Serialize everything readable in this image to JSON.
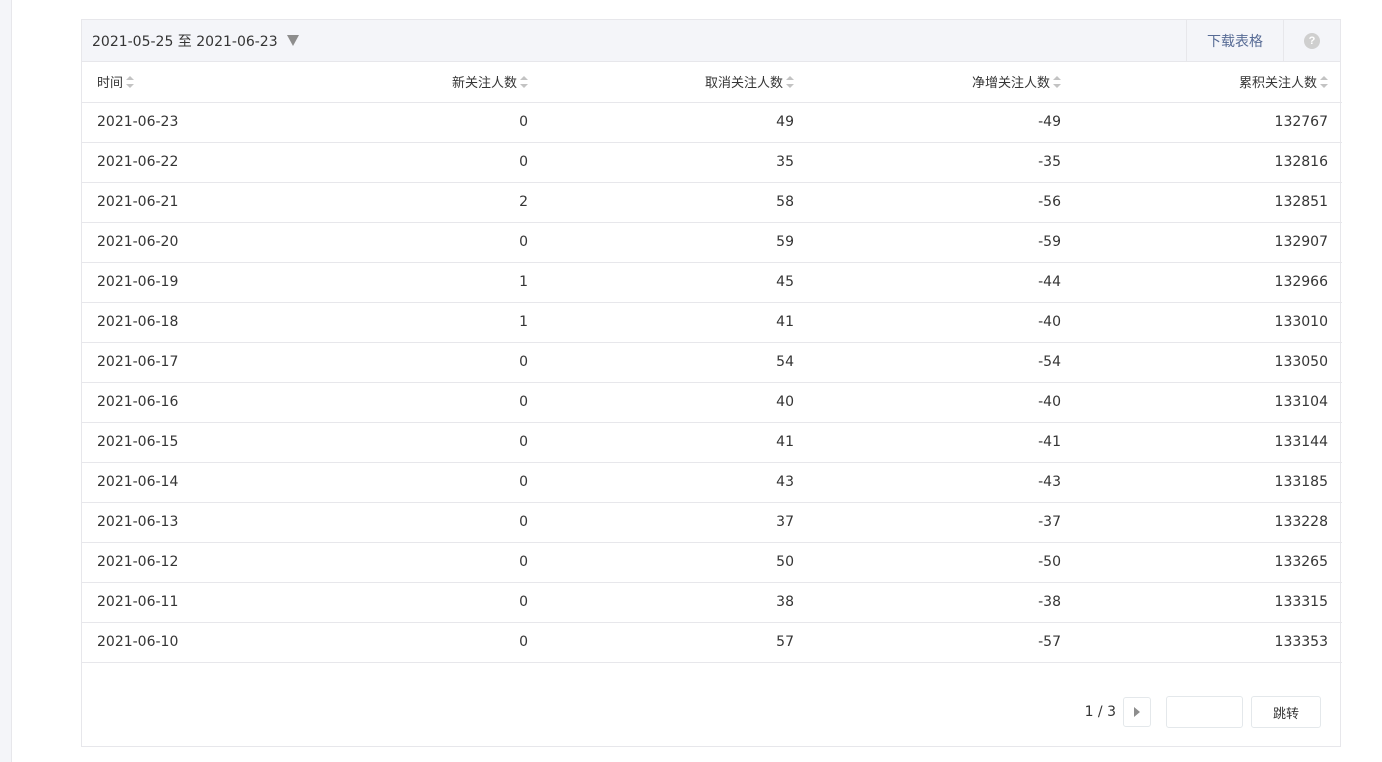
{
  "toolbar": {
    "date_range": "2021-05-25 至 2021-06-23",
    "download_label": "下载表格",
    "help_icon": "question-circle-icon"
  },
  "table": {
    "columns": [
      "时间",
      "新关注人数",
      "取消关注人数",
      "净增关注人数",
      "累积关注人数"
    ],
    "rows": [
      [
        "2021-06-23",
        "0",
        "49",
        "-49",
        "132767"
      ],
      [
        "2021-06-22",
        "0",
        "35",
        "-35",
        "132816"
      ],
      [
        "2021-06-21",
        "2",
        "58",
        "-56",
        "132851"
      ],
      [
        "2021-06-20",
        "0",
        "59",
        "-59",
        "132907"
      ],
      [
        "2021-06-19",
        "1",
        "45",
        "-44",
        "132966"
      ],
      [
        "2021-06-18",
        "1",
        "41",
        "-40",
        "133010"
      ],
      [
        "2021-06-17",
        "0",
        "54",
        "-54",
        "133050"
      ],
      [
        "2021-06-16",
        "0",
        "40",
        "-40",
        "133104"
      ],
      [
        "2021-06-15",
        "0",
        "41",
        "-41",
        "133144"
      ],
      [
        "2021-06-14",
        "0",
        "43",
        "-43",
        "133185"
      ],
      [
        "2021-06-13",
        "0",
        "37",
        "-37",
        "133228"
      ],
      [
        "2021-06-12",
        "0",
        "50",
        "-50",
        "133265"
      ],
      [
        "2021-06-11",
        "0",
        "38",
        "-38",
        "133315"
      ],
      [
        "2021-06-10",
        "0",
        "57",
        "-57",
        "133353"
      ]
    ]
  },
  "pager": {
    "page_text": "1 / 3",
    "input_value": "",
    "jump_label": "跳转"
  },
  "colors": {
    "link": "#576b95",
    "border": "#e7e7eb",
    "header_bg": "#f4f5f9"
  }
}
